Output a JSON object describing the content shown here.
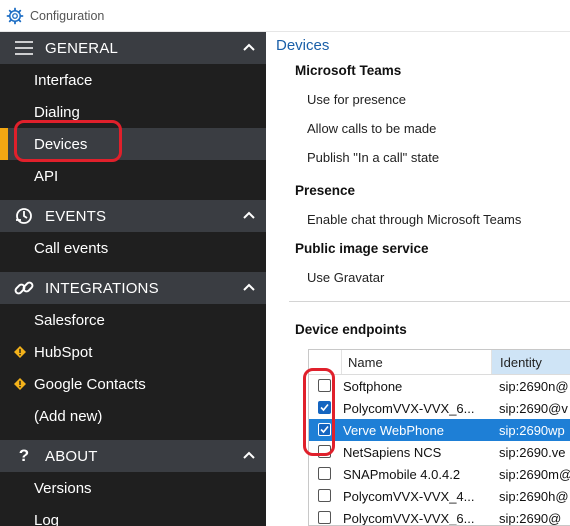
{
  "window": {
    "title": "Configuration"
  },
  "sidebar": {
    "sections": [
      {
        "key": "general",
        "label": "GENERAL",
        "icon": "hamburger-icon",
        "items": [
          "Interface",
          "Dialing",
          "Devices",
          "API"
        ]
      },
      {
        "key": "events",
        "label": "EVENTS",
        "icon": "events-icon",
        "items": [
          "Call events"
        ]
      },
      {
        "key": "integrations",
        "label": "INTEGRATIONS",
        "icon": "link-icon",
        "items": [
          "Salesforce",
          "HubSpot",
          "Google Contacts",
          "(Add new)"
        ]
      },
      {
        "key": "about",
        "label": "ABOUT",
        "icon": "question-icon",
        "items": [
          "Versions",
          "Log"
        ]
      }
    ],
    "selected": "Devices"
  },
  "content": {
    "title": "Devices",
    "groups": [
      {
        "title": "Microsoft Teams",
        "options": [
          "Use for presence",
          "Allow calls to be made",
          "Publish \"In a call\" state"
        ]
      },
      {
        "title": "Presence",
        "options": [
          "Enable chat through Microsoft Teams"
        ]
      },
      {
        "title": "Public image service",
        "options": [
          "Use Gravatar"
        ]
      }
    ],
    "endpoints": {
      "title": "Device endpoints",
      "columns": [
        "Name",
        "Identity"
      ],
      "rows": [
        {
          "name": "Softphone",
          "identity": "sip:2690n@",
          "checked": false,
          "selected": false
        },
        {
          "name": "PolycomVVX-VVX_6...",
          "identity": "sip:2690@v",
          "checked": true,
          "selected": false
        },
        {
          "name": "Verve WebPhone",
          "identity": "sip:2690wp",
          "checked": true,
          "selected": true
        },
        {
          "name": "NetSapiens NCS",
          "identity": "sip:2690.ve",
          "checked": false,
          "selected": false
        },
        {
          "name": "SNAPmobile 4.0.4.2",
          "identity": "sip:2690m@",
          "checked": false,
          "selected": false
        },
        {
          "name": "PolycomVVX-VVX_4...",
          "identity": "sip:2690h@",
          "checked": false,
          "selected": false
        },
        {
          "name": "PolycomVVX-VVX_6...",
          "identity": "sip:2690@",
          "checked": false,
          "selected": false
        }
      ]
    }
  },
  "colors": {
    "accent": "#f3a712",
    "highlight": "#e0202b",
    "link": "#1a5fa8",
    "selection": "#1e7fd6"
  }
}
